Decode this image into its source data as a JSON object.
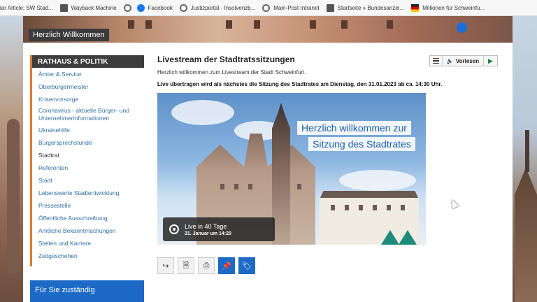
{
  "bookmarks": [
    {
      "label": "lar Article: SW Stad...",
      "icon": "document-icon"
    },
    {
      "label": "Wayback Machine",
      "icon": "document-icon"
    },
    {
      "label": "",
      "icon": "globe-icon"
    },
    {
      "label": "Facebook",
      "icon": "facebook-icon"
    },
    {
      "label": "Justizportal - Insolvenzb...",
      "icon": "globe-icon"
    },
    {
      "label": "Main-Post Intranet",
      "icon": "globe-icon"
    },
    {
      "label": "Startseite » Bundesanzei...",
      "icon": "document-icon"
    },
    {
      "label": "Millionen für Schweinfu...",
      "icon": "flag-icon"
    }
  ],
  "header": {
    "title": "Herzlich Willkommen"
  },
  "sidebar": {
    "heading": "RATHAUS & POLITIK",
    "items": [
      {
        "label": "Ämter & Service"
      },
      {
        "label": "Oberbürgermeister"
      },
      {
        "label": "Krisenvorsorge"
      },
      {
        "label": "Coronavirus - aktuelle Bürger- und Unternehmerinformationen"
      },
      {
        "label": "Ukrainehilfe"
      },
      {
        "label": "Bürgersprechstunde"
      },
      {
        "label": "Stadtrat"
      },
      {
        "label": "Referenten"
      },
      {
        "label": "Stadt"
      },
      {
        "label": "Lebenswerte Stadtentwicklung"
      },
      {
        "label": "Pressestelle"
      },
      {
        "label": "Öffentliche Ausschreibung"
      },
      {
        "label": "Amtliche Bekanntmachungen"
      },
      {
        "label": "Stellen und Karriere"
      },
      {
        "label": "Zeitgeschehen"
      }
    ],
    "box_label": "Für Sie zuständig"
  },
  "main": {
    "title": "Livestream der Stadtratssitzungen",
    "intro": "Herzlich willkommen zum Livestream der Stadt Schweinfurt.",
    "live_note": "Live übertragen wird als nächstes die Sitzung des Stadtrates am Dienstag, den 31.01.2023 ab ca. 14:30 Uhr.",
    "hero_line1": "Herzlich willkommen zur",
    "hero_line2": "Sitzung des Stadtrates",
    "live_title": "Live in 40 Tage",
    "live_date": "31. Januar um 14:20"
  },
  "toolbar": {
    "vorlesen_label": "Vorlesen"
  },
  "actions": [
    {
      "icon": "share-icon"
    },
    {
      "icon": "pdf-icon"
    },
    {
      "icon": "print-icon"
    },
    {
      "icon": "pin-icon"
    },
    {
      "icon": "tag-icon"
    }
  ]
}
